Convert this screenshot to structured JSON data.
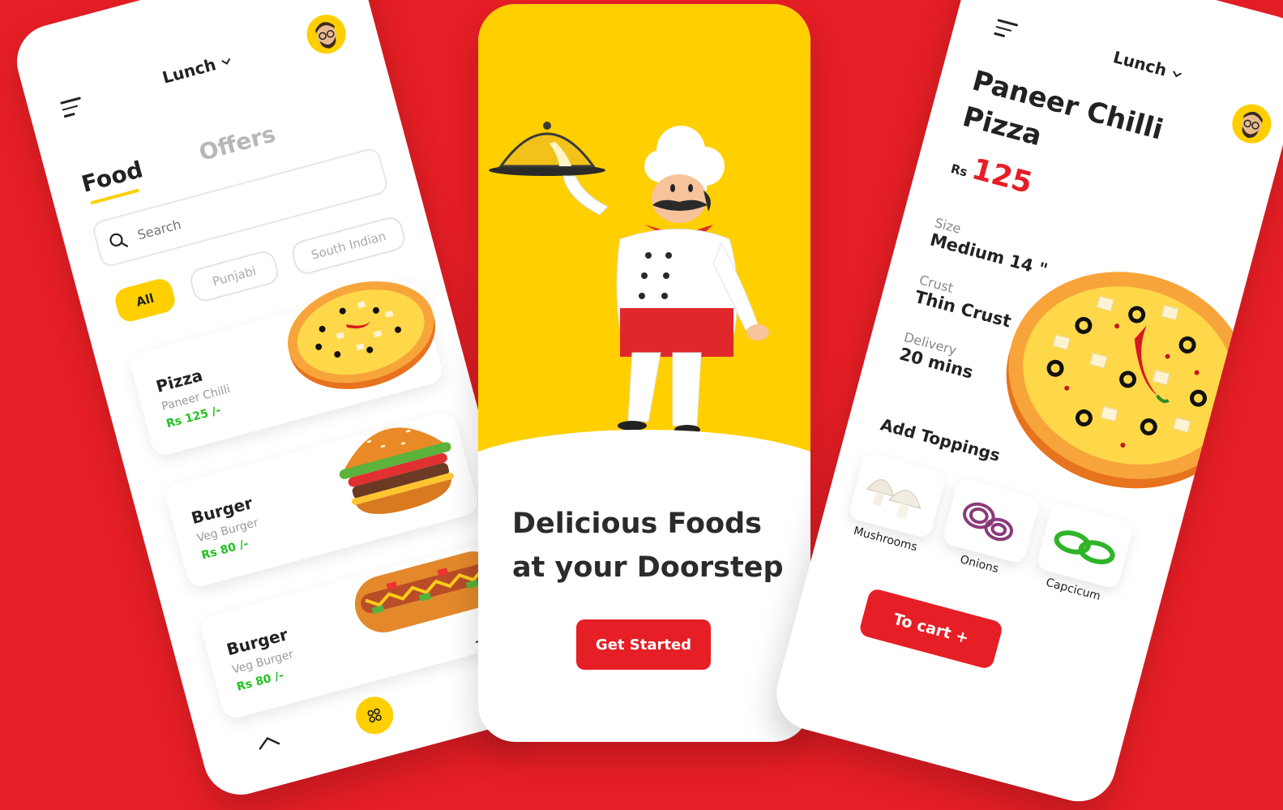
{
  "left_app": {
    "meal_select": "Lunch",
    "tabs": [
      {
        "label": "Food",
        "active": true
      },
      {
        "label": "Offers",
        "active": false
      }
    ],
    "search": {
      "placeholder": "Search"
    },
    "categories": [
      {
        "label": "All",
        "active": true
      },
      {
        "label": "Punjabi",
        "active": false
      },
      {
        "label": "South Indian",
        "active": false
      }
    ],
    "items": [
      {
        "name": "Pizza",
        "subtitle": "Paneer Chilli",
        "price": "Rs 125 /-",
        "icon": "pizza-icon"
      },
      {
        "name": "Burger",
        "subtitle": "Veg Burger",
        "price": "Rs 80 /-",
        "icon": "burger-icon"
      },
      {
        "name": "Burger",
        "subtitle": "Veg Burger",
        "price": "Rs 80 /-",
        "icon": "hotdog-icon"
      }
    ],
    "bottom_nav": {
      "cart_label": "Cart"
    }
  },
  "splash": {
    "headline_line1": "Delicious Foods",
    "headline_line2": "at your Doorstep",
    "cta_label": "Get Started"
  },
  "detail_app": {
    "meal_select": "Lunch",
    "title_line1": "Paneer Chilli",
    "title_line2": "Pizza",
    "currency": "Rs",
    "price": "125",
    "specs": [
      {
        "label": "Size",
        "value": "Medium 14 \""
      },
      {
        "label": "Crust",
        "value": "Thin Crust"
      },
      {
        "label": "Delivery",
        "value": "20 mins"
      }
    ],
    "toppings_title": "Add Toppings",
    "toppings": [
      {
        "label": "Mushrooms",
        "icon": "mushroom-icon"
      },
      {
        "label": "Onions",
        "icon": "onion-icon"
      },
      {
        "label": "Capcicum",
        "icon": "capsicum-icon"
      }
    ],
    "cart_button": "To cart +"
  },
  "colors": {
    "background": "#e61e25",
    "accent_yellow": "#ffcf00",
    "price_green": "#1ec21e",
    "brand_red": "#e61e25"
  }
}
